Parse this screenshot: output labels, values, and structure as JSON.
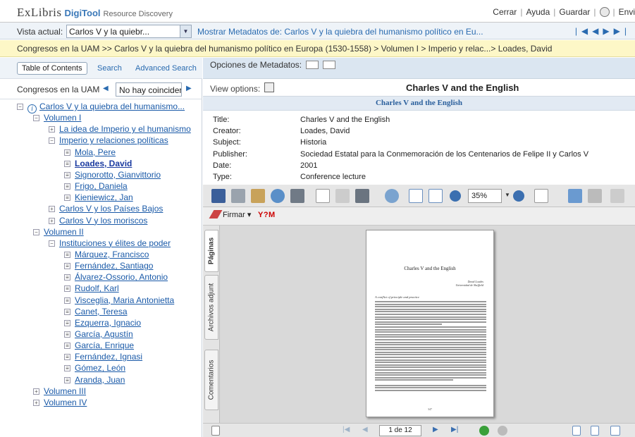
{
  "topbar": {
    "logo_main": "ExLibris",
    "logo_product": "DigiTool",
    "logo_tagline": "Resource Discovery",
    "links": [
      "Cerrar",
      "Ayuda",
      "Guardar",
      "Envi"
    ]
  },
  "viewbar": {
    "label": "Vista actual:",
    "select_value": "Carlos V y la quiebr...",
    "metadata_label": "Mostrar Metadatos de:",
    "metadata_value": "Carlos V y la quiebra del humanismo político en Eu..."
  },
  "breadcrumb": "Congresos en la UAM >> Carlos V y la quiebra del humanismo político en Europa (1530-1558) > Volumen I > Imperio y relac...> Loades, David",
  "left": {
    "toc_button": "Table of Contents",
    "search_tab": "Search",
    "advanced_tab": "Advanced Search",
    "collection_label": "Congresos en la UAM",
    "collection_filter": "No hay coincider",
    "tree": [
      {
        "label": "Carlos V y la quiebra del humanismo...",
        "level": 0,
        "icon": "minus",
        "info": true
      },
      {
        "label": "Volumen I",
        "level": 1,
        "icon": "minus"
      },
      {
        "label": "La idea de Imperio y el humanismo",
        "level": 2,
        "icon": "plus"
      },
      {
        "label": "Imperio y relaciones políticas",
        "level": 2,
        "icon": "minus"
      },
      {
        "label": "Mola, Pere",
        "level": 3,
        "icon": "doc"
      },
      {
        "label": "Loades, David",
        "level": 3,
        "icon": "doc",
        "active": true
      },
      {
        "label": "Signorotto, Gianvittorio",
        "level": 3,
        "icon": "doc"
      },
      {
        "label": "Frigo, Daniela",
        "level": 3,
        "icon": "doc"
      },
      {
        "label": "Kieniewicz, Jan",
        "level": 3,
        "icon": "doc"
      },
      {
        "label": "Carlos V y los Países Bajos",
        "level": 2,
        "icon": "plus"
      },
      {
        "label": "Carlos V y los moriscos",
        "level": 2,
        "icon": "plus"
      },
      {
        "label": "Volumen II",
        "level": 1,
        "icon": "minus"
      },
      {
        "label": "Instituciones y élites de poder",
        "level": 2,
        "icon": "minus"
      },
      {
        "label": "Márquez, Francisco",
        "level": 3,
        "icon": "doc"
      },
      {
        "label": "Fernández, Santiago",
        "level": 3,
        "icon": "doc"
      },
      {
        "label": "Álvarez-Ossorio, Antonio",
        "level": 3,
        "icon": "doc"
      },
      {
        "label": "Rudolf, Karl",
        "level": 3,
        "icon": "doc"
      },
      {
        "label": "Visceglia, Maria Antonietta",
        "level": 3,
        "icon": "doc"
      },
      {
        "label": "Canet, Teresa",
        "level": 3,
        "icon": "doc"
      },
      {
        "label": "Ezquerra, Ignacio",
        "level": 3,
        "icon": "doc"
      },
      {
        "label": "García, Agustín",
        "level": 3,
        "icon": "doc"
      },
      {
        "label": "García, Enrique",
        "level": 3,
        "icon": "doc"
      },
      {
        "label": "Fernández, Ignasi",
        "level": 3,
        "icon": "doc"
      },
      {
        "label": "Gómez, León",
        "level": 3,
        "icon": "doc"
      },
      {
        "label": "Aranda, Juan",
        "level": 3,
        "icon": "doc"
      },
      {
        "label": "Volumen III",
        "level": 1,
        "icon": "plus"
      },
      {
        "label": "Volumen IV",
        "level": 1,
        "icon": "plus"
      }
    ]
  },
  "right": {
    "meta_options_label": "Opciones de Metadatos:",
    "view_options_label": "View options:",
    "doc_title": "Charles V and the English",
    "meta_header": "Charles V and the English",
    "metadata": [
      {
        "key": "Title:",
        "value": "Charles V and the English"
      },
      {
        "key": "Creator:",
        "value": "Loades, David"
      },
      {
        "key": "Subject:",
        "value": "Historia"
      },
      {
        "key": "Publisher:",
        "value": "Sociedad Estatal para la Conmemoración de los Centenarios de Felipe II y Carlos V"
      },
      {
        "key": "Date:",
        "value": "2001"
      },
      {
        "key": "Type:",
        "value": "Conference lecture"
      }
    ]
  },
  "viewer": {
    "zoom": "35%",
    "sign_button": "Firmar",
    "ylogo": "Y?M",
    "tabs": [
      "Páginas",
      "Archivos adjunt",
      "Comentarios"
    ],
    "page_title": "Charles V and the English",
    "page_author": "David Loades",
    "page_affiliation": "Universidad de Sheffield",
    "page_heading": "A conflict of principle and practice",
    "page_number": "347",
    "page_indicator": "1 de 12"
  }
}
